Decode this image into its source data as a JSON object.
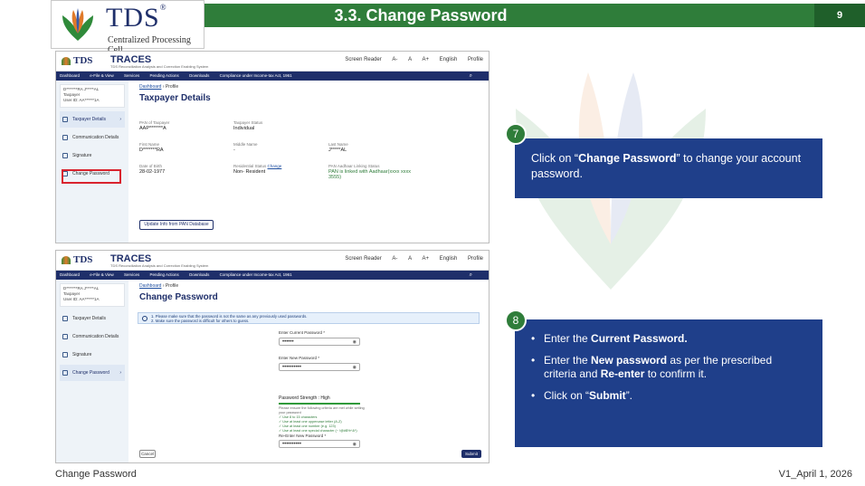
{
  "slide": {
    "title": "3.3. Change Password",
    "page_number": "9",
    "footer_left": "Change Password",
    "footer_right": "V1_April 1, 2026"
  },
  "logo": {
    "name": "TDS",
    "subtitle": "Centralized Processing Cell"
  },
  "app": {
    "logo": "TDS",
    "name": "TRACES",
    "tagline": "TDS Reconciliation Analysis and Correction Enabling System",
    "header_links": [
      "Screen Reader",
      "A-",
      "A",
      "A+",
      "English",
      "Profile"
    ],
    "nav": [
      "Dashboard",
      "e-File & View",
      "Services",
      "Pending Actions",
      "Downloads",
      "Compliance under Income-tax Act, 1961"
    ],
    "user": {
      "name": "D*******RA J*****AL",
      "role": "Taxpayer",
      "id_label": "User ID: AA******1A"
    },
    "sidebar": [
      "Taxpayer Details",
      "Communication Details",
      "Signature",
      "Change Password"
    ],
    "breadcrumb_root": "Dashboard",
    "breadcrumb_current": "Profile"
  },
  "profile_screen": {
    "heading": "Taxpayer Details",
    "fields": [
      {
        "label": "PAN of Taxpayer",
        "value": "AAP*******A"
      },
      {
        "label": "Taxpayer Status",
        "value": "Individual"
      },
      {
        "label": "First Name",
        "value": "D*******RA"
      },
      {
        "label": "Middle Name",
        "value": "-"
      },
      {
        "label": "Last Name",
        "value": "J*****AL"
      },
      {
        "label": "Date of Birth",
        "value": "28-02-1977"
      },
      {
        "label": "Residential Status",
        "value": "Non- Resident",
        "link": "Change"
      },
      {
        "label": "PAN Aadhaar Linking Status",
        "value": "PAN is linked with Aadhaar(xxxx xxxx 3555)"
      }
    ],
    "update_button": "Update Info from PAN Database"
  },
  "password_screen": {
    "heading": "Change Password",
    "info": [
      "1. Please make sure that the password is not the same as any previously used passwords.",
      "2. Make sure the password is difficult for others to guess."
    ],
    "current_label": "Enter Current Password *",
    "current_value": "••••••",
    "new_label": "Enter New Password *",
    "new_value": "••••••••••",
    "strength": "Password Strength : High",
    "criteria_note": "Please ensure the following criteria are met while setting your password",
    "criteria": [
      "Use 8 to 15 characters",
      "Use at least one uppercase letter (A-Z)",
      "Use at least one number (e.g. 123)",
      "Use at least one special character (~ !@#$%^&*)"
    ],
    "reenter_label": "Re-Enter New Password *",
    "reenter_value": "••••••••••",
    "cancel": "Cancel",
    "submit": "Submit"
  },
  "callouts": {
    "step7": "7",
    "step7_pre": "Click on “",
    "step7_bold": "Change Password",
    "step7_post": "” to change your account password.",
    "step8": "8",
    "b1_pre": "Enter the ",
    "b1_bold": "Current Password.",
    "b2_pre": "Enter the ",
    "b2_bold": "New password",
    "b2_mid": " as per the prescribed criteria and ",
    "b2_bold2": "Re-enter",
    "b2_post": " to confirm it.",
    "b3_pre": "Click on “",
    "b3_bold": "Submit",
    "b3_post": "”."
  },
  "colors": {
    "header_green": "#2f7d3a",
    "callout_blue": "#1f3f8a",
    "app_navy": "#1f2f6a",
    "highlight_red": "#d9232e"
  }
}
